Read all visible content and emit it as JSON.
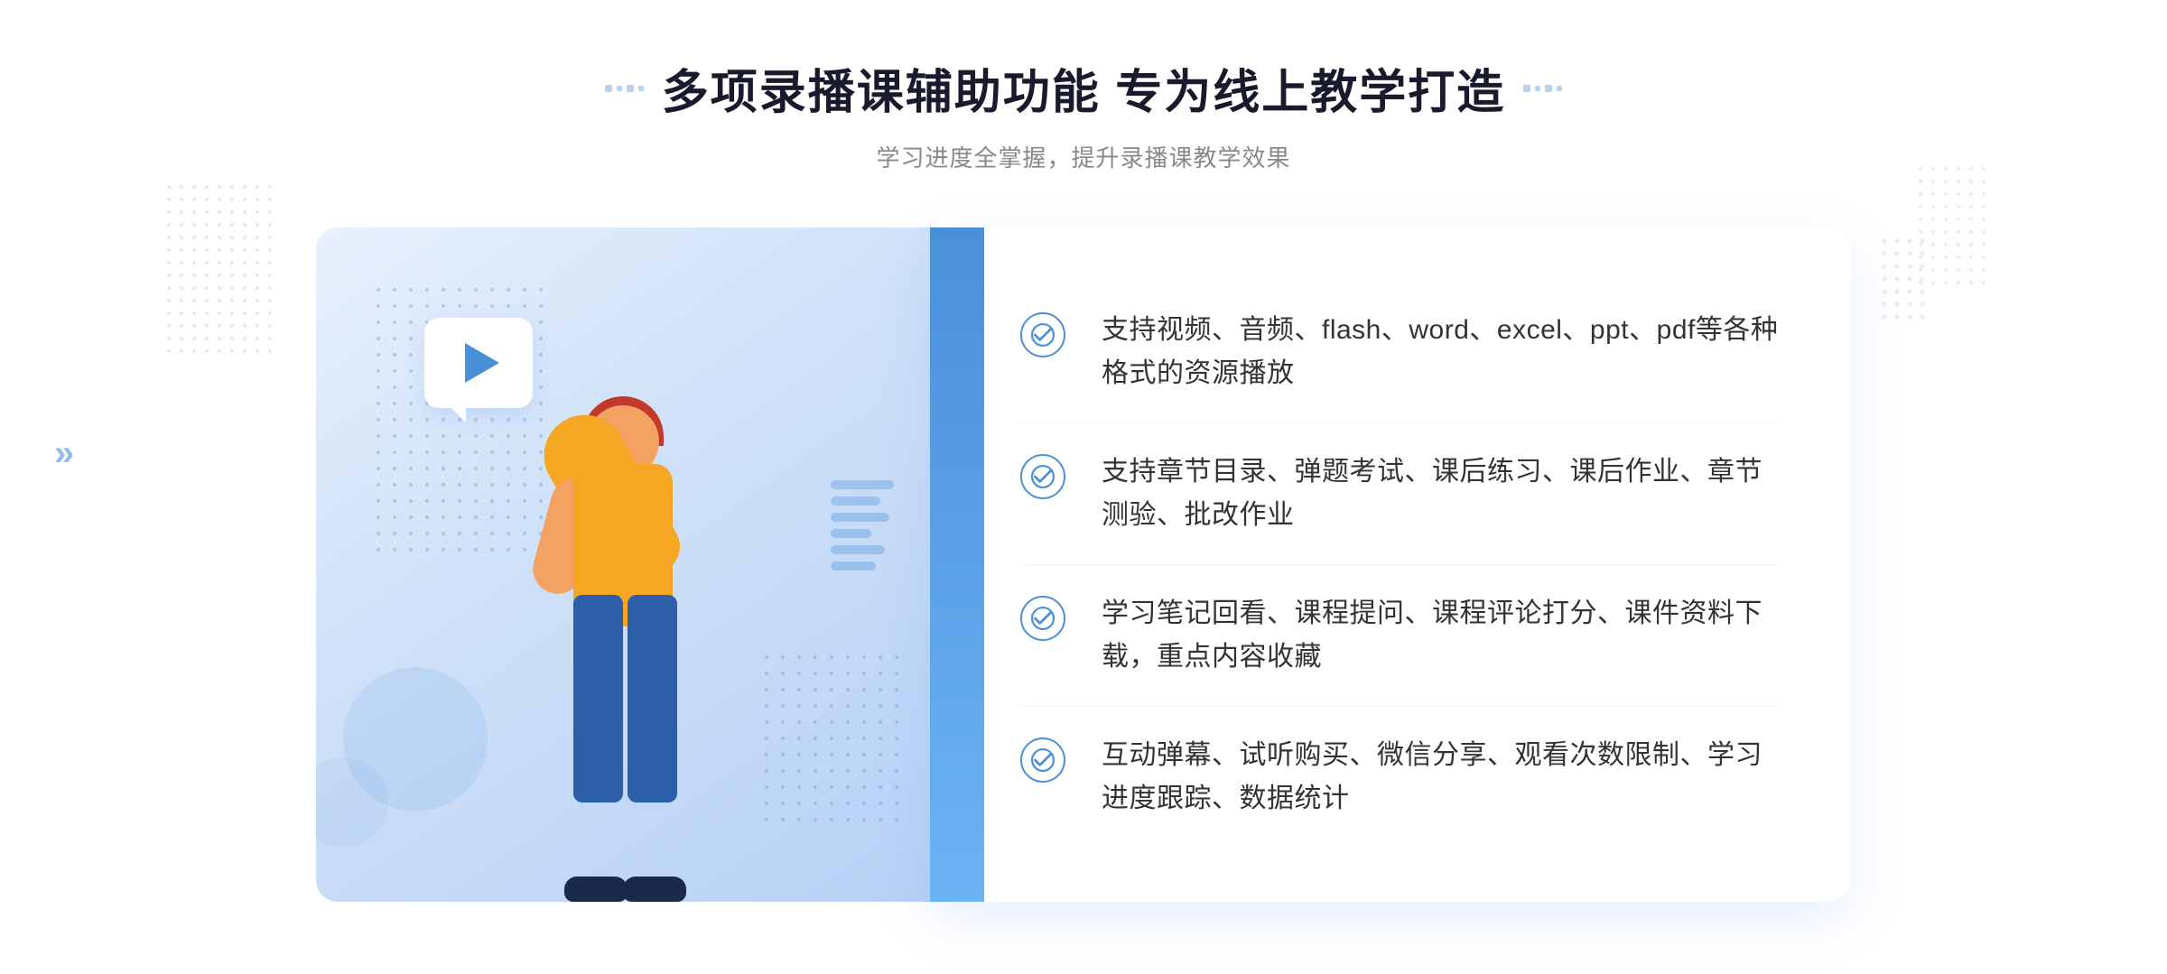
{
  "header": {
    "title": "多项录播课辅助功能 专为线上教学打造",
    "subtitle": "学习进度全掌握，提升录播课教学效果"
  },
  "features": [
    {
      "id": "feature-1",
      "text": "支持视频、音频、flash、word、excel、ppt、pdf等各种格式的资源播放"
    },
    {
      "id": "feature-2",
      "text": "支持章节目录、弹题考试、课后练习、课后作业、章节测验、批改作业"
    },
    {
      "id": "feature-3",
      "text": "学习笔记回看、课程提问、课程评论打分、课件资料下载，重点内容收藏"
    },
    {
      "id": "feature-4",
      "text": "互动弹幕、试听购买、微信分享、观看次数限制、学习进度跟踪、数据统计"
    }
  ],
  "deco": {
    "chevron": "»"
  }
}
